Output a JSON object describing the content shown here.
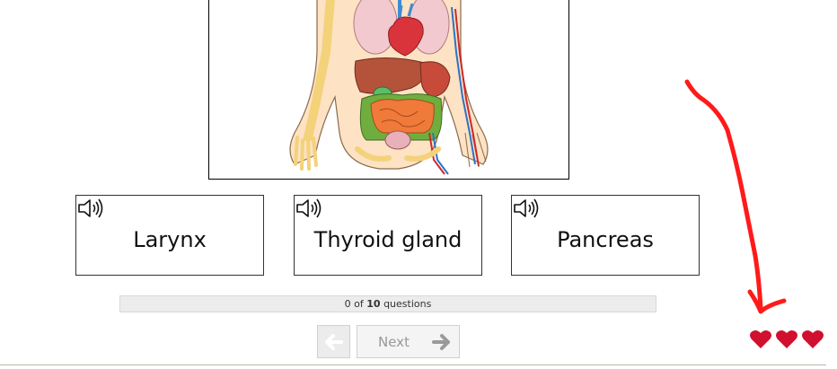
{
  "answers": [
    {
      "label": "Larynx",
      "audio_icon": "speaker-icon"
    },
    {
      "label": "Thyroid gland",
      "audio_icon": "speaker-icon"
    },
    {
      "label": "Pancreas",
      "audio_icon": "speaker-icon"
    }
  ],
  "progress": {
    "current": "0",
    "of": "of",
    "total": "10",
    "unit": "questions",
    "fraction": 0
  },
  "nav": {
    "prev_icon": "arrow-left-icon",
    "next_label": "Next",
    "next_icon": "arrow-right-icon"
  },
  "lives": {
    "count": 3,
    "icon": "heart-icon",
    "color": "#d0102e"
  },
  "annotation": {
    "icon": "hand-drawn-arrow-icon",
    "color": "#ff1a1a"
  },
  "colors": {
    "card_border": "#333333",
    "progress_bg": "#ececec",
    "button_bg": "#f4f4f4",
    "button_text": "#999999"
  }
}
